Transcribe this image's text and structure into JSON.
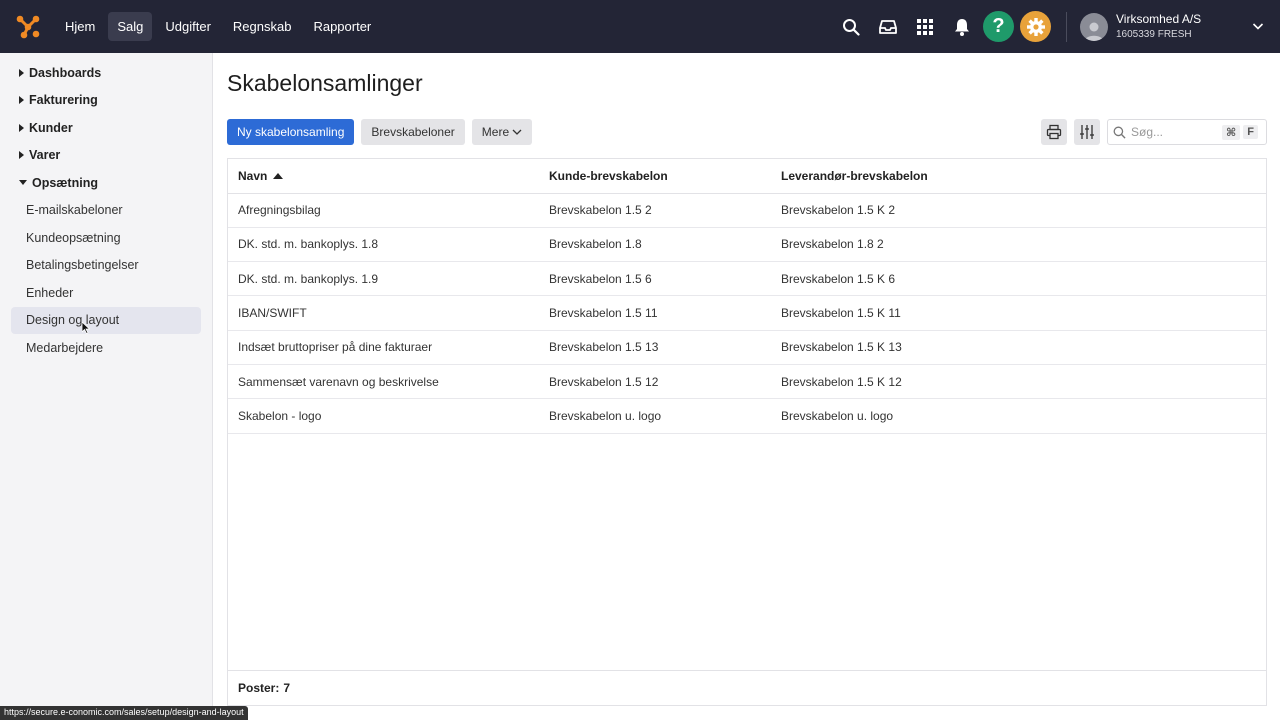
{
  "topbar": {
    "nav": [
      "Hjem",
      "Salg",
      "Udgifter",
      "Regnskab",
      "Rapporter"
    ],
    "active_nav": "Salg",
    "icons": [
      "search-icon",
      "inbox-icon",
      "apps-grid-icon",
      "bell-icon"
    ],
    "help_label": "?",
    "account": {
      "name": "Virksomhed A/S",
      "sub": "1605339 FRESH"
    }
  },
  "sidebar": {
    "groups": [
      {
        "label": "Dashboards",
        "expanded": false
      },
      {
        "label": "Fakturering",
        "expanded": false
      },
      {
        "label": "Kunder",
        "expanded": false
      },
      {
        "label": "Varer",
        "expanded": false
      },
      {
        "label": "Opsætning",
        "expanded": true
      }
    ],
    "items": [
      "E-mailskabeloner",
      "Kundeopsætning",
      "Betalingsbetingelser",
      "Enheder",
      "Design og layout",
      "Medarbejdere"
    ],
    "active_item": "Design og layout"
  },
  "main": {
    "title": "Skabelonsamlinger",
    "buttons": {
      "new": "Ny skabelonsamling",
      "letters": "Brevskabeloner",
      "more": "Mere"
    },
    "search": {
      "placeholder": "Søg...",
      "kbd1": "⌘",
      "kbd2": "F"
    },
    "table": {
      "headers": [
        "Navn",
        "Kunde-brevskabelon",
        "Leverandør-brevskabelon"
      ],
      "rows": [
        [
          "Afregningsbilag",
          "Brevskabelon 1.5 2",
          "Brevskabelon 1.5 K 2"
        ],
        [
          "DK. std. m. bankoplys. 1.8",
          "Brevskabelon 1.8",
          "Brevskabelon 1.8 2"
        ],
        [
          "DK. std. m. bankoplys. 1.9",
          "Brevskabelon 1.5 6",
          "Brevskabelon 1.5 K 6"
        ],
        [
          "IBAN/SWIFT",
          "Brevskabelon 1.5 11",
          "Brevskabelon 1.5 K 11"
        ],
        [
          "Indsæt bruttopriser på dine fakturaer",
          "Brevskabelon 1.5 13",
          "Brevskabelon 1.5 K 13"
        ],
        [
          "Sammensæt varenavn og beskrivelse",
          "Brevskabelon 1.5 12",
          "Brevskabelon 1.5 K 12"
        ],
        [
          "Skabelon - logo",
          "Brevskabelon u. logo",
          "Brevskabelon u. logo"
        ]
      ],
      "footer_label": "Poster:",
      "footer_count": "7"
    }
  },
  "statusbar": {
    "url": "https://secure.e-conomic.com/sales/setup/design-and-layout"
  },
  "colors": {
    "topbar": "#232536",
    "primary": "#2d6bd6",
    "help": "#1f9a6a",
    "gear": "#e8a23a"
  }
}
